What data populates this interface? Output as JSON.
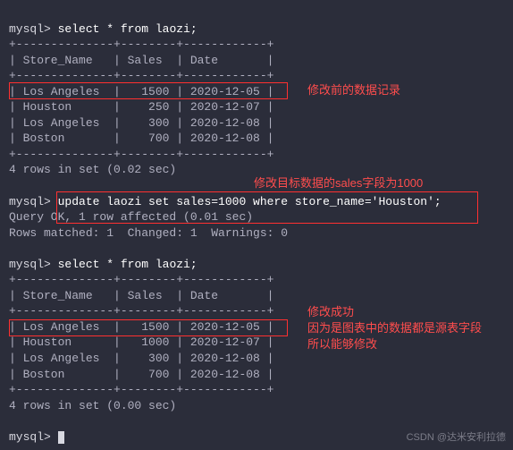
{
  "prompt": "mysql>",
  "queries": {
    "select": "select * from laozi;",
    "update": "update laozi set sales=1000 where store_name='Houston';"
  },
  "table": {
    "sep_top": "+--------------+--------+------------+",
    "header": "| Store_Name   | Sales  | Date       |",
    "rows_before": [
      "| Los Angeles  |   1500 | 2020-12-05 |",
      "| Houston      |    250 | 2020-12-07 |",
      "| Los Angeles  |    300 | 2020-12-08 |",
      "| Boston       |    700 | 2020-12-08 |"
    ],
    "rows_after": [
      "| Los Angeles  |   1500 | 2020-12-05 |",
      "| Houston      |   1000 | 2020-12-07 |",
      "| Los Angeles  |    300 | 2020-12-08 |",
      "| Boston       |    700 | 2020-12-08 |"
    ]
  },
  "msgs": {
    "rows_02": "4 rows in set (0.02 sec)",
    "rows_00": "4 rows in set (0.00 sec)",
    "query_ok": "Query OK, 1 row affected (0.01 sec)",
    "matched": "Rows matched: 1  Changed: 1  Warnings: 0"
  },
  "annotations": {
    "a1": "修改前的数据记录",
    "a2": "修改目标数据的sales字段为1000",
    "a3_line1": "修改成功",
    "a3_line2": "因为是图表中的数据都是源表字段",
    "a3_line3": "所以能够修改"
  },
  "watermark": "CSDN @达米安利拉德"
}
